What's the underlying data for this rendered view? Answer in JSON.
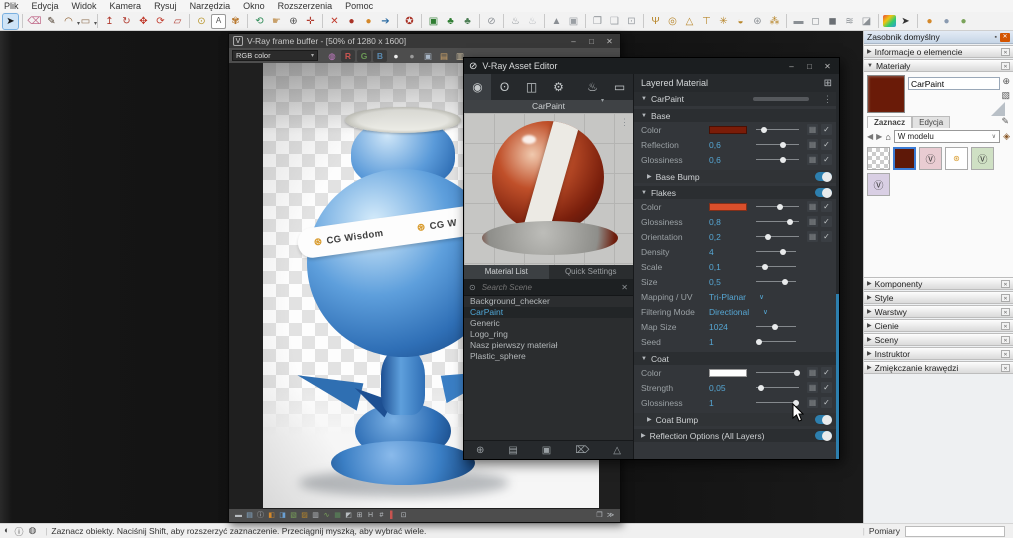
{
  "menu": {
    "items": [
      "Plik",
      "Edycja",
      "Widok",
      "Kamera",
      "Rysuj",
      "Narzędzia",
      "Okno",
      "Rozszerzenia",
      "Pomoc"
    ]
  },
  "main_toolbar": {
    "icons": [
      {
        "name": "select-tool",
        "glyph": "➤",
        "color": "#1a1a1a",
        "active": true
      },
      {
        "sep": true
      },
      {
        "name": "eraser-tool",
        "glyph": "⌫",
        "color": "#c06a8a"
      },
      {
        "name": "line-tool",
        "glyph": "✎",
        "color": "#4a3a2a"
      },
      {
        "name": "arc-tool",
        "glyph": "◠",
        "color": "#8a5a2a",
        "caret": true
      },
      {
        "name": "rectangle-tool",
        "glyph": "▭",
        "color": "#8a6a4a",
        "caret": true
      },
      {
        "sep": true
      },
      {
        "name": "push-pull-tool",
        "glyph": "↥",
        "color": "#b03a2e"
      },
      {
        "name": "follow-me-tool",
        "glyph": "↻",
        "color": "#b03a2e"
      },
      {
        "name": "move-tool",
        "glyph": "✥",
        "color": "#c0392b"
      },
      {
        "name": "rotate-tool",
        "glyph": "⟳",
        "color": "#c0392b"
      },
      {
        "name": "scale-tool",
        "glyph": "▱",
        "color": "#b03a2e"
      },
      {
        "sep": true
      },
      {
        "name": "tape-measure-tool",
        "glyph": "⊙",
        "color": "#b8952a"
      },
      {
        "name": "text-tool",
        "glyph": "A",
        "color": "#555555",
        "boxed": true
      },
      {
        "name": "paint-bucket-tool",
        "glyph": "✾",
        "color": "#b8762a"
      },
      {
        "sep": true
      },
      {
        "name": "orbit-tool",
        "glyph": "⟲",
        "color": "#2e8b57"
      },
      {
        "name": "pan-tool",
        "glyph": "☛",
        "color": "#c8a06a"
      },
      {
        "name": "zoom-tool",
        "glyph": "⊕",
        "color": "#555555"
      },
      {
        "name": "zoom-extents-tool",
        "glyph": "✛",
        "color": "#b03a2e"
      },
      {
        "sep": true
      },
      {
        "name": "zoom-window-icon",
        "glyph": "✕",
        "color": "#c0392b"
      },
      {
        "name": "vray-render-icon",
        "glyph": "●",
        "color": "#a93226"
      },
      {
        "name": "vray-render-last-icon",
        "glyph": "●",
        "color": "#d4882a"
      },
      {
        "name": "vray-export-icon",
        "glyph": "➔",
        "color": "#2e6da4"
      },
      {
        "sep": true
      },
      {
        "name": "vray-scene-settings-icon",
        "glyph": "✪",
        "color": "#a93226"
      },
      {
        "sep": true
      },
      {
        "name": "vray-frame-buffer-toolbar-icon",
        "glyph": "▣",
        "color": "#2e7d32"
      },
      {
        "name": "cosmos-browser-icon",
        "glyph": "♣",
        "color": "#2e7d32"
      },
      {
        "name": "cosmos-assets-icon",
        "glyph": "♣",
        "color": "#4a7d52"
      },
      {
        "sep": true
      },
      {
        "name": "vray-asset-editor-toolbar-icon",
        "glyph": "⊘",
        "color": "#8a8f94"
      },
      {
        "sep": true
      },
      {
        "name": "render-teapot-icon",
        "glyph": "♨",
        "color": "#8a8f94"
      },
      {
        "name": "render-interactive-icon",
        "glyph": "♨",
        "color": "#b5b9bd"
      },
      {
        "sep": true
      },
      {
        "name": "viewport-render-icon",
        "glyph": "▲",
        "color": "#8a8f94"
      },
      {
        "name": "viewport-render-region-icon",
        "glyph": "▣",
        "color": "#9a9fa4"
      },
      {
        "sep": true
      },
      {
        "name": "batch-render-icon",
        "glyph": "❐",
        "color": "#8a8f94"
      },
      {
        "name": "batch-render-all-icon",
        "glyph": "❑",
        "color": "#9a9fa4"
      },
      {
        "name": "lock-scene-icon",
        "glyph": "⊡",
        "color": "#9a9fa4"
      },
      {
        "sep": true
      },
      {
        "name": "rect-light-icon",
        "glyph": "Ψ",
        "color": "#b8862a"
      },
      {
        "name": "sphere-light-icon",
        "glyph": "◎",
        "color": "#b8862a"
      },
      {
        "name": "spot-light-icon",
        "glyph": "△",
        "color": "#b8862a"
      },
      {
        "name": "ies-light-icon",
        "glyph": "⊤",
        "color": "#b8862a"
      },
      {
        "name": "omni-light-icon",
        "glyph": "✳",
        "color": "#b8862a"
      },
      {
        "name": "dome-light-icon",
        "glyph": "◒",
        "color": "#b8862a"
      },
      {
        "name": "mesh-light-icon",
        "glyph": "⊛",
        "color": "#8a8f94"
      },
      {
        "name": "light-gen-icon",
        "glyph": "⁂",
        "color": "#b8862a"
      },
      {
        "sep": true
      },
      {
        "name": "infinite-plane-icon",
        "glyph": "▬",
        "color": "#8a8f94"
      },
      {
        "name": "proxy-mesh-icon",
        "glyph": "◻",
        "color": "#8a8f94"
      },
      {
        "name": "proxy-export-icon",
        "glyph": "◼",
        "color": "#6a6f74"
      },
      {
        "name": "fur-icon",
        "glyph": "≋",
        "color": "#8a8f94"
      },
      {
        "name": "decal-icon",
        "glyph": "◪",
        "color": "#8a8f94"
      },
      {
        "sep": true
      },
      {
        "name": "color-picker-icon",
        "glyph": "",
        "bg": "linear-gradient(135deg,#e74c3c,#f1c40f 35%,#2ecc71 65%,#3498db)"
      },
      {
        "name": "picker-cursor-icon",
        "glyph": "➤",
        "color": "#333333"
      },
      {
        "sep": true
      },
      {
        "name": "cosmos-material-ball-icon",
        "glyph": "●",
        "color": "#d4882a"
      },
      {
        "name": "cosmos-model-ball-icon",
        "glyph": "●",
        "color": "#8a9ab0"
      },
      {
        "name": "cosmos-vegetation-ball-icon",
        "glyph": "●",
        "color": "#7aa35a"
      }
    ]
  },
  "vfb": {
    "title": "V-Ray frame buffer - [50% of 1280 x 1600]",
    "logo": "V",
    "channel_dropdown": "RGB color",
    "toolbar_icons": [
      {
        "name": "display-correction-icon",
        "glyph": "◍",
        "color": "#c77bc7"
      },
      {
        "name": "red-channel-button",
        "label": "R",
        "color": "#c75450",
        "boxed": true
      },
      {
        "name": "green-channel-button",
        "label": "G",
        "color": "#6a9955",
        "boxed": true
      },
      {
        "name": "blue-channel-button",
        "label": "B",
        "color": "#5a8ab0",
        "boxed": true
      },
      {
        "name": "alpha-channel-icon",
        "glyph": "●",
        "color": "#eeeeee"
      },
      {
        "name": "mono-channel-icon",
        "glyph": "●",
        "color": "#9a9a9a"
      },
      {
        "name": "save-image-icon",
        "glyph": "▣",
        "color": "#aab8c8"
      },
      {
        "name": "open-image-icon",
        "glyph": "▤",
        "color": "#d4a86a"
      },
      {
        "name": "clear-image-icon",
        "glyph": "▥",
        "color": "#d8c8a8"
      }
    ],
    "bottom_icons": [
      {
        "name": "vfb-panel-icon",
        "glyph": "▬",
        "color": "#b8bcc0"
      },
      {
        "name": "vfb-history-icon",
        "glyph": "▤",
        "color": "#8ab0d0"
      },
      {
        "name": "vfb-info-icon",
        "glyph": "ⓘ",
        "color": "#b8bcc0"
      },
      {
        "name": "vfb-exposure-icon",
        "glyph": "◧",
        "color": "#d4882a"
      },
      {
        "name": "vfb-white-balance-icon",
        "glyph": "◨",
        "color": "#6aa0d4"
      },
      {
        "name": "vfb-hue-icon",
        "glyph": "▧",
        "color": "#7aa35a"
      },
      {
        "name": "vfb-color-balance-icon",
        "glyph": "▨",
        "color": "#b8862a"
      },
      {
        "name": "vfb-levels-icon",
        "glyph": "▥",
        "color": "#b8bcc0"
      },
      {
        "name": "vfb-curves-icon",
        "glyph": "∿",
        "color": "#7aa35a"
      },
      {
        "name": "vfb-background-icon",
        "glyph": "▦",
        "color": "#5a8a5a"
      },
      {
        "name": "vfb-lut-icon",
        "glyph": "◩",
        "color": "#b8bcc0"
      },
      {
        "name": "vfb-ocio-icon",
        "glyph": "⊞",
        "color": "#b8bcc0"
      },
      {
        "name": "vfb-icc-icon",
        "glyph": "H",
        "color": "#b8bcc0"
      },
      {
        "name": "vfb-stamp-icon",
        "glyph": "#",
        "color": "#b8bcc0"
      },
      {
        "name": "vfb-stereo-icon",
        "glyph": "▌",
        "color": "#c75450"
      },
      {
        "name": "vfb-region-render-icon",
        "glyph": "⊡",
        "color": "#b8bcc0"
      }
    ],
    "bottom_right_icons": [
      {
        "name": "vfb-dock-icon",
        "glyph": "❐",
        "color": "#b8bcc0"
      },
      {
        "name": "vfb-collapse-icon",
        "glyph": "≫",
        "color": "#b8bcc0"
      }
    ],
    "render": {
      "brand": "CG Wisdom",
      "brand_partial": "CG W"
    }
  },
  "asset_editor": {
    "title": "V-Ray Asset Editor",
    "nav_icons": [
      {
        "name": "materials-tab",
        "glyph": "◉",
        "active": true
      },
      {
        "name": "lights-tab",
        "glyph": "ʘ"
      },
      {
        "name": "geometries-tab",
        "glyph": "◫"
      },
      {
        "name": "settings-tab",
        "glyph": "⚙"
      }
    ],
    "nav_right_icons": [
      {
        "name": "render-button",
        "glyph": "♨",
        "caret": true
      },
      {
        "name": "frame-buffer-button",
        "glyph": "▭"
      }
    ],
    "preview_title": "CarPaint",
    "tabs": [
      "Material List",
      "Quick Settings"
    ],
    "search_placeholder": "Search Scene",
    "materials": [
      {
        "label": "Background_checker"
      },
      {
        "label": "CarPaint",
        "selected": true
      },
      {
        "label": "Generic"
      },
      {
        "label": "Logo_ring"
      },
      {
        "label": "Nasz pierwszy materiał"
      },
      {
        "label": "Plastic_sphere"
      }
    ],
    "footer_icons": [
      {
        "name": "cosmos-footer-icon",
        "glyph": "⊕"
      },
      {
        "name": "open-material-icon",
        "glyph": "▤"
      },
      {
        "name": "save-material-icon",
        "glyph": "▣"
      },
      {
        "name": "delete-material-icon",
        "glyph": "⌦"
      },
      {
        "name": "pack-material-icon",
        "glyph": "△"
      }
    ],
    "right": {
      "header": "Layered Material",
      "items": [
        {
          "kind": "layer",
          "label": "CarPaint"
        },
        {
          "kind": "section",
          "label": "Base"
        },
        {
          "kind": "row",
          "label": "Color",
          "swatch": "#7a1c08",
          "slider": 18,
          "texture": true,
          "check": true
        },
        {
          "kind": "row",
          "label": "Reflection",
          "value": "0,6",
          "slider": 62,
          "texture": true,
          "check": true
        },
        {
          "kind": "row",
          "label": "Glossiness",
          "value": "0,6",
          "slider": 62,
          "texture": true,
          "check": true
        },
        {
          "kind": "toggle",
          "label": "Base Bump",
          "on": true,
          "indent": true
        },
        {
          "kind": "sectionToggle",
          "label": "Flakes",
          "on": true
        },
        {
          "kind": "row",
          "label": "Color",
          "swatch": "#d94f2b",
          "slider": 55,
          "texture": true,
          "check": true
        },
        {
          "kind": "row",
          "label": "Glossiness",
          "value": "0,8",
          "slider": 78,
          "texture": true,
          "check": true
        },
        {
          "kind": "row",
          "label": "Orientation",
          "value": "0,2",
          "slider": 28,
          "texture": true,
          "check": true
        },
        {
          "kind": "row",
          "label": "Density",
          "value": "4",
          "slider": 68
        },
        {
          "kind": "row",
          "label": "Scale",
          "value": "0,1",
          "slider": 22
        },
        {
          "kind": "row",
          "label": "Size",
          "value": "0,5",
          "slider": 72
        },
        {
          "kind": "select",
          "label": "Mapping / UV",
          "value": "Tri-Planar",
          "caret": "mid"
        },
        {
          "kind": "select",
          "label": "Filtering Mode",
          "value": "Directional",
          "caret": "right"
        },
        {
          "kind": "row",
          "label": "Map Size",
          "value": "1024",
          "slider": 48
        },
        {
          "kind": "row",
          "label": "Seed",
          "value": "1",
          "slider": 8
        },
        {
          "kind": "section",
          "label": "Coat"
        },
        {
          "kind": "row",
          "label": "Color",
          "swatch": "#ffffff",
          "slider": 95,
          "texture": true,
          "check": true
        },
        {
          "kind": "row",
          "label": "Strength",
          "value": "0,05",
          "slider": 12,
          "texture": true,
          "check": true
        },
        {
          "kind": "row",
          "label": "Glossiness",
          "value": "1",
          "slider": 93,
          "texture": true,
          "check": true
        },
        {
          "kind": "toggle",
          "label": "Coat Bump",
          "on": true,
          "indent": true
        },
        {
          "kind": "toggle",
          "label": "Reflection Options (All Layers)",
          "on": true
        }
      ]
    }
  },
  "tray": {
    "title": "Zasobnik domyślny",
    "sections": [
      "Informacje o elemencie",
      "Materiały"
    ],
    "materials_panel": {
      "name": "CarPaint",
      "tabs": [
        "Zaznacz",
        "Edycja"
      ],
      "dropdown": "W modelu",
      "swatches": [
        {
          "name": "material-default-swatch",
          "type": "checker"
        },
        {
          "name": "material-carpaint-swatch",
          "color": "#5e1808",
          "selected": true
        },
        {
          "name": "material-pink-swatch",
          "color": "#e9ccd2",
          "vray": true
        },
        {
          "name": "material-logo-ring-swatch",
          "color": "#ffffff",
          "logo": true
        },
        {
          "name": "material-green-swatch",
          "color": "#cfe0c4",
          "vray": true
        },
        {
          "name": "material-purple-swatch",
          "color": "#d9cfe4",
          "vray": true
        }
      ]
    },
    "collapsed_sections": [
      "Komponenty",
      "Style",
      "Warstwy",
      "Cienie",
      "Sceny",
      "Instruktor",
      "Zmiękczanie krawędzi"
    ]
  },
  "status_bar": {
    "icons": [
      {
        "name": "model-credit-icon",
        "glyph": "◐"
      },
      {
        "name": "geolocation-icon",
        "glyph": "ⓘ"
      },
      {
        "name": "claim-credit-icon",
        "glyph": "◍"
      }
    ],
    "hint": "Zaznacz obiekty. Naciśnij Shift, aby rozszerzyć zaznaczenie. Przeciągnij myszką, aby wybrać wiele.",
    "measure_label": "Pomiary"
  },
  "colors": {
    "accent_blue": "#4fa8d8",
    "toggle_blue": "#2d7fae",
    "base_color": "#7a1c08",
    "flakes_color": "#d94f2b",
    "coat_color": "#ffffff",
    "selection_border": "#3a7bd5"
  }
}
